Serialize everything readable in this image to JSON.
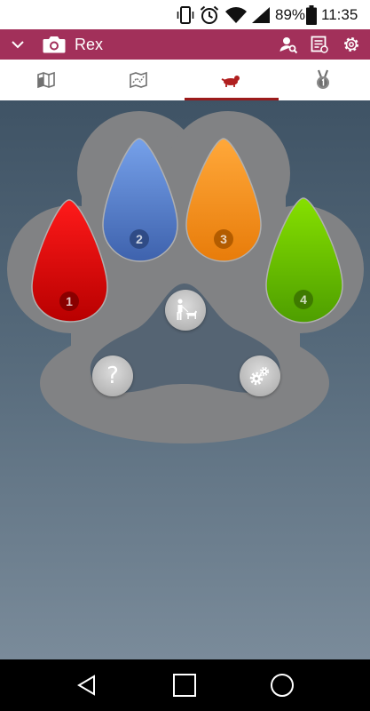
{
  "status_bar": {
    "battery_percent": "89%",
    "time": "11:35"
  },
  "app_bar": {
    "title": "Rex"
  },
  "tabs": [
    {
      "icon": "map-icon",
      "selected": false
    },
    {
      "icon": "route-map-icon",
      "selected": false
    },
    {
      "icon": "dog-tracker-icon",
      "selected": true
    },
    {
      "icon": "medal-icon",
      "selected": false
    }
  ],
  "paw": {
    "toes": [
      {
        "label": "1",
        "color": "#d40000"
      },
      {
        "label": "2",
        "color": "#5b7fcc"
      },
      {
        "label": "3",
        "color": "#f08a1c"
      },
      {
        "label": "4",
        "color": "#5fb800"
      }
    ],
    "buttons": [
      "walk-dog-icon",
      "help-icon",
      "settings-gears-icon"
    ],
    "help_label": "?"
  },
  "colors": {
    "app_bar": "#a2305a",
    "tab_indicator": "#9b1b1b",
    "paw_pad": "#818284"
  }
}
